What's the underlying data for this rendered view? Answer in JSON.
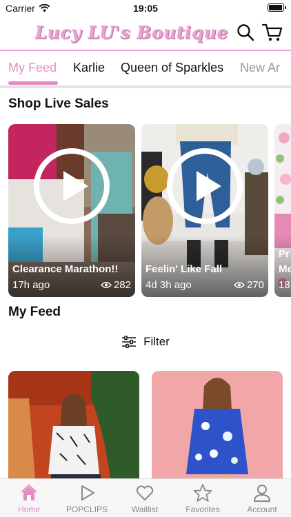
{
  "status_bar": {
    "carrier": "Carrier",
    "time": "19:05"
  },
  "header": {
    "logo_text": "Lucy LU's Boutique"
  },
  "tabs": [
    {
      "label": "My Feed"
    },
    {
      "label": "Karlie"
    },
    {
      "label": "Queen of Sparkles"
    },
    {
      "label": "New Ar"
    }
  ],
  "live_section": {
    "title": "Shop Live Sales",
    "cards": [
      {
        "title": "Clearance Marathon!!",
        "ago": "17h ago",
        "views": "282"
      },
      {
        "title": "Feelin' Like Fall",
        "ago": "4d 3h ago",
        "views": "270"
      },
      {
        "title": "Pr",
        "subtitle": "Me",
        "ago": "18"
      }
    ]
  },
  "feed_section": {
    "title": "My Feed",
    "filter_label": "Filter"
  },
  "bottom_nav": [
    {
      "label": "Home"
    },
    {
      "label": "POPCLIPS"
    },
    {
      "label": "Waitlist"
    },
    {
      "label": "Favorites"
    },
    {
      "label": "Account"
    }
  ],
  "colors": {
    "accent": "#e58bc3",
    "header_line": "#e8a3cf",
    "logo": "#e7a2cf"
  }
}
